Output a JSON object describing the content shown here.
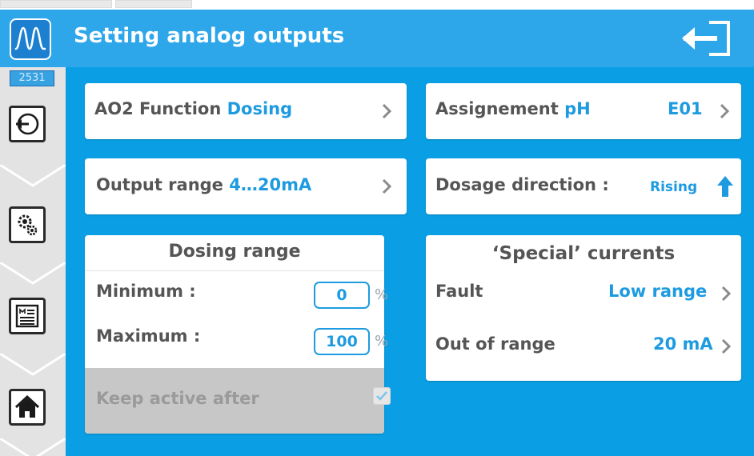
{
  "header": {
    "title": "Setting analog outputs",
    "logo_icon": "waveform-icon",
    "exit_icon": "exit-icon",
    "colors": {
      "header_bg": "#2ea6ea",
      "content_bg": "#0a9fe4",
      "accent": "#1e9be0"
    }
  },
  "sidebar": {
    "code": "2531",
    "items": [
      {
        "icon": "back-arrow-circle-icon"
      },
      {
        "icon": "gears-icon"
      },
      {
        "icon": "menu-list-icon"
      },
      {
        "icon": "home-icon"
      }
    ]
  },
  "function_card": {
    "label": "AO2 Function",
    "value": "Dosing"
  },
  "assignment_card": {
    "label": "Assignement",
    "value": "pH",
    "channel": "E01"
  },
  "range_card": {
    "label": "Output range",
    "value": "4…20mA"
  },
  "direction_card": {
    "label": "Dosage direction :",
    "value": "Rising",
    "icon": "arrow-up-icon"
  },
  "dosing_range": {
    "heading": "Dosing range",
    "minimum_label": "Minimum :",
    "minimum_value": "0",
    "maximum_label": "Maximum :",
    "maximum_value": "100",
    "unit": "%",
    "keep_active_label": "Keep active after",
    "keep_active_checked": true
  },
  "special_currents": {
    "heading": "‘Special’ currents",
    "fault_label": "Fault",
    "fault_value": "Low range",
    "out_of_range_label": "Out of range",
    "out_of_range_value": "20 mA"
  }
}
